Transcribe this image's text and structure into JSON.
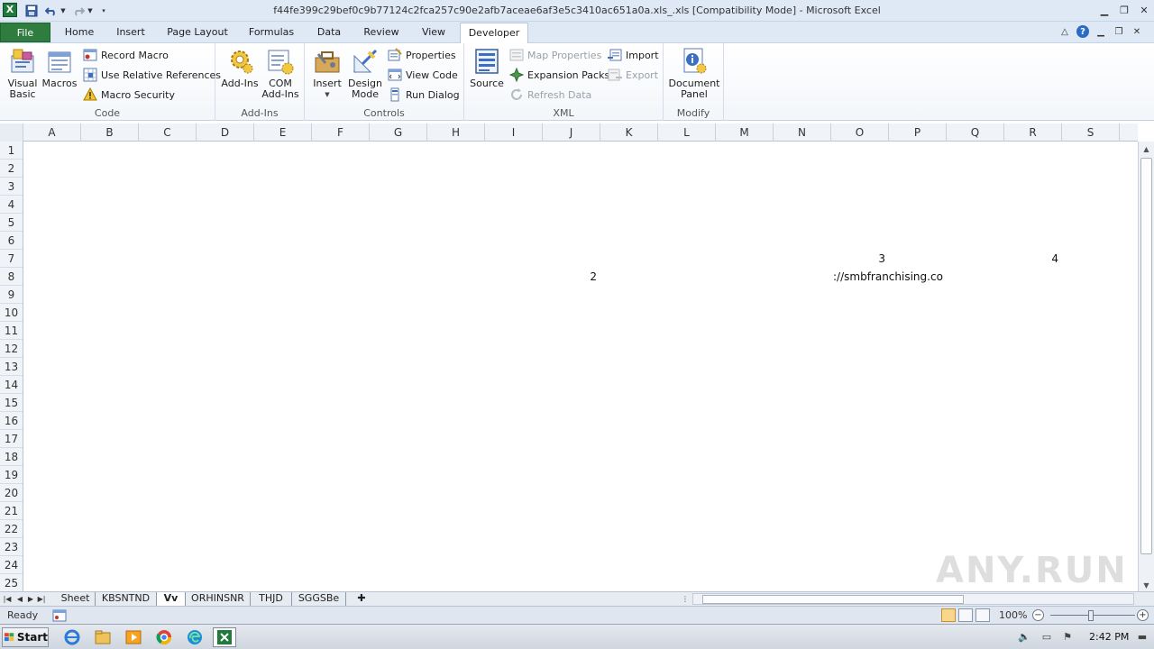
{
  "window": {
    "title": "f44fe399c29bef0c9b77124c2fca257c90e2afb7aceae6af3e5c3410ac651a0a.xls_.xls  [Compatibility Mode]  -  Microsoft Excel",
    "app_icon_letter": "X"
  },
  "ribbon_tabs": [
    {
      "label": "File"
    },
    {
      "label": "Home"
    },
    {
      "label": "Insert"
    },
    {
      "label": "Page Layout"
    },
    {
      "label": "Formulas"
    },
    {
      "label": "Data"
    },
    {
      "label": "Review"
    },
    {
      "label": "View"
    },
    {
      "label": "Developer",
      "active": true
    }
  ],
  "ribbon": {
    "code": {
      "label": "Code",
      "visual_basic": [
        "Visual",
        "Basic"
      ],
      "macros": "Macros",
      "record_macro": "Record Macro",
      "use_relative": "Use Relative References",
      "macro_security": "Macro Security"
    },
    "addins": {
      "label": "Add-Ins",
      "addins": "Add-Ins",
      "com_addins": [
        "COM",
        "Add-Ins"
      ]
    },
    "controls": {
      "label": "Controls",
      "insert": "Insert",
      "design_mode": [
        "Design",
        "Mode"
      ],
      "properties": "Properties",
      "view_code": "View Code",
      "run_dialog": "Run Dialog"
    },
    "xml": {
      "label": "XML",
      "source": "Source",
      "map_properties": "Map Properties",
      "expansion_packs": "Expansion Packs",
      "refresh_data": "Refresh Data",
      "import": "Import",
      "export": "Export"
    },
    "modify": {
      "label": "Modify",
      "document_panel": [
        "Document",
        "Panel"
      ]
    }
  },
  "columns": [
    "A",
    "B",
    "C",
    "D",
    "E",
    "F",
    "G",
    "H",
    "I",
    "J",
    "K",
    "L",
    "M",
    "N",
    "O",
    "P",
    "Q",
    "R",
    "S"
  ],
  "rows": [
    "1",
    "2",
    "3",
    "4",
    "5",
    "6",
    "7",
    "8",
    "9",
    "10",
    "11",
    "12",
    "13",
    "14",
    "15",
    "16",
    "17",
    "18",
    "19",
    "20",
    "21",
    "22",
    "23",
    "24",
    "25"
  ],
  "cells": [
    {
      "ref": "O7",
      "value": "3"
    },
    {
      "ref": "R7",
      "value": "4"
    },
    {
      "ref": "J8",
      "value": "2"
    },
    {
      "ref": "O8",
      "value": "://smbfranchising.co"
    }
  ],
  "sheet_tabs": [
    {
      "label": "Sheet"
    },
    {
      "label": "KBSNTND"
    },
    {
      "label": "Vv",
      "active": true
    },
    {
      "label": "ORHINSNR"
    },
    {
      "label": "THJD"
    },
    {
      "label": "SGGSBe"
    }
  ],
  "status": {
    "ready": "Ready",
    "zoom": "100%"
  },
  "taskbar": {
    "start": "Start",
    "time": "2:42 PM"
  },
  "watermark": "ANY.RUN"
}
